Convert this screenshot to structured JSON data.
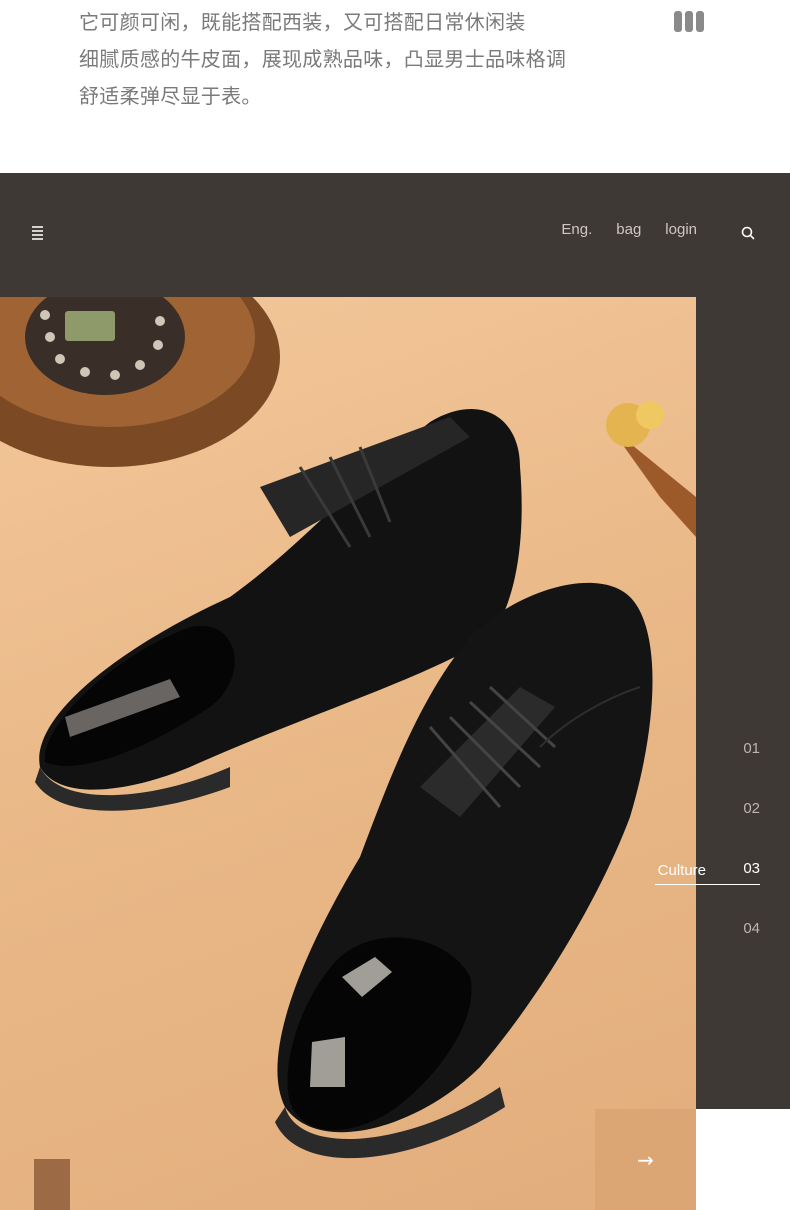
{
  "intro": {
    "lines": [
      "它可颜可闲，既能搭配西装，又可搭配日常休闲装",
      "细腻质感的牛皮面，展现成熟品味，凸显男士品味格调",
      "舒适柔弹尽显于表。"
    ]
  },
  "nav": {
    "links": [
      "Eng.",
      "bag",
      "login"
    ],
    "menu_icon": "hamburger-icon",
    "search_icon": "search-icon"
  },
  "slides": {
    "items": [
      "01",
      "02",
      "03",
      "04"
    ],
    "active_index": 2,
    "active_label": "Culture"
  },
  "controls": {
    "next_label": "→"
  },
  "colors": {
    "dark_bg": "#3f3935",
    "accent": "#dca674",
    "accent_dark": "#9c6a45",
    "text_gray": "#7a7a7a"
  }
}
